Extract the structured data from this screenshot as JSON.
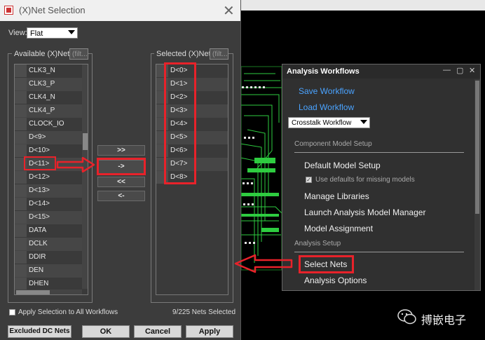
{
  "net_dialog": {
    "title": "(X)Net Selection",
    "close_glyph": "✕",
    "view_label": "View:",
    "view_value": "Flat",
    "available": {
      "title": "Available (X)Nets",
      "filter_placeholder": "(filt...",
      "items": [
        "CLK3_N",
        "CLK3_P",
        "CLK4_N",
        "CLK4_P",
        "CLOCK_IO",
        "D<9>",
        "D<10>",
        "D<11>",
        "D<12>",
        "D<13>",
        "D<14>",
        "D<15>",
        "DATA",
        "DCLK",
        "DDIR",
        "DEN",
        "DHEN"
      ]
    },
    "selected": {
      "title": "Selected (X)Nets",
      "filter_placeholder": "(filt...",
      "items": [
        "D<0>",
        "D<1>",
        "D<2>",
        "D<3>",
        "D<4>",
        "D<5>",
        "D<6>",
        "D<7>",
        "D<8>"
      ]
    },
    "move_buttons": [
      ">>",
      "->",
      "<<",
      "<-"
    ],
    "apply_all_label": "Apply Selection to All Workflows",
    "status": "9/225 Nets Selected",
    "buttons": {
      "excluded": "Excluded DC Nets",
      "ok": "OK",
      "cancel": "Cancel",
      "apply": "Apply"
    }
  },
  "analysis_workflows": {
    "title": "Analysis Workflows",
    "window_controls": [
      "—",
      "▢",
      "✕"
    ],
    "save": "Save Workflow",
    "load": "Load Workflow",
    "workflow_value": "Crosstalk Workflow",
    "section_component": "Component Model Setup",
    "default_model": "Default Model Setup",
    "use_defaults": "Use defaults for missing models",
    "manage_libraries": "Manage Libraries",
    "launch_manager": "Launch Analysis Model Manager",
    "model_assignment": "Model Assignment",
    "section_analysis": "Analysis Setup",
    "select_nets": "Select Nets",
    "analysis_options": "Analysis Options"
  },
  "watermark": {
    "text": "搏嵌电子"
  },
  "colors": {
    "highlight": "#e8222a",
    "link": "#4aa3ff",
    "pcb_trace": "#2ecc40"
  }
}
